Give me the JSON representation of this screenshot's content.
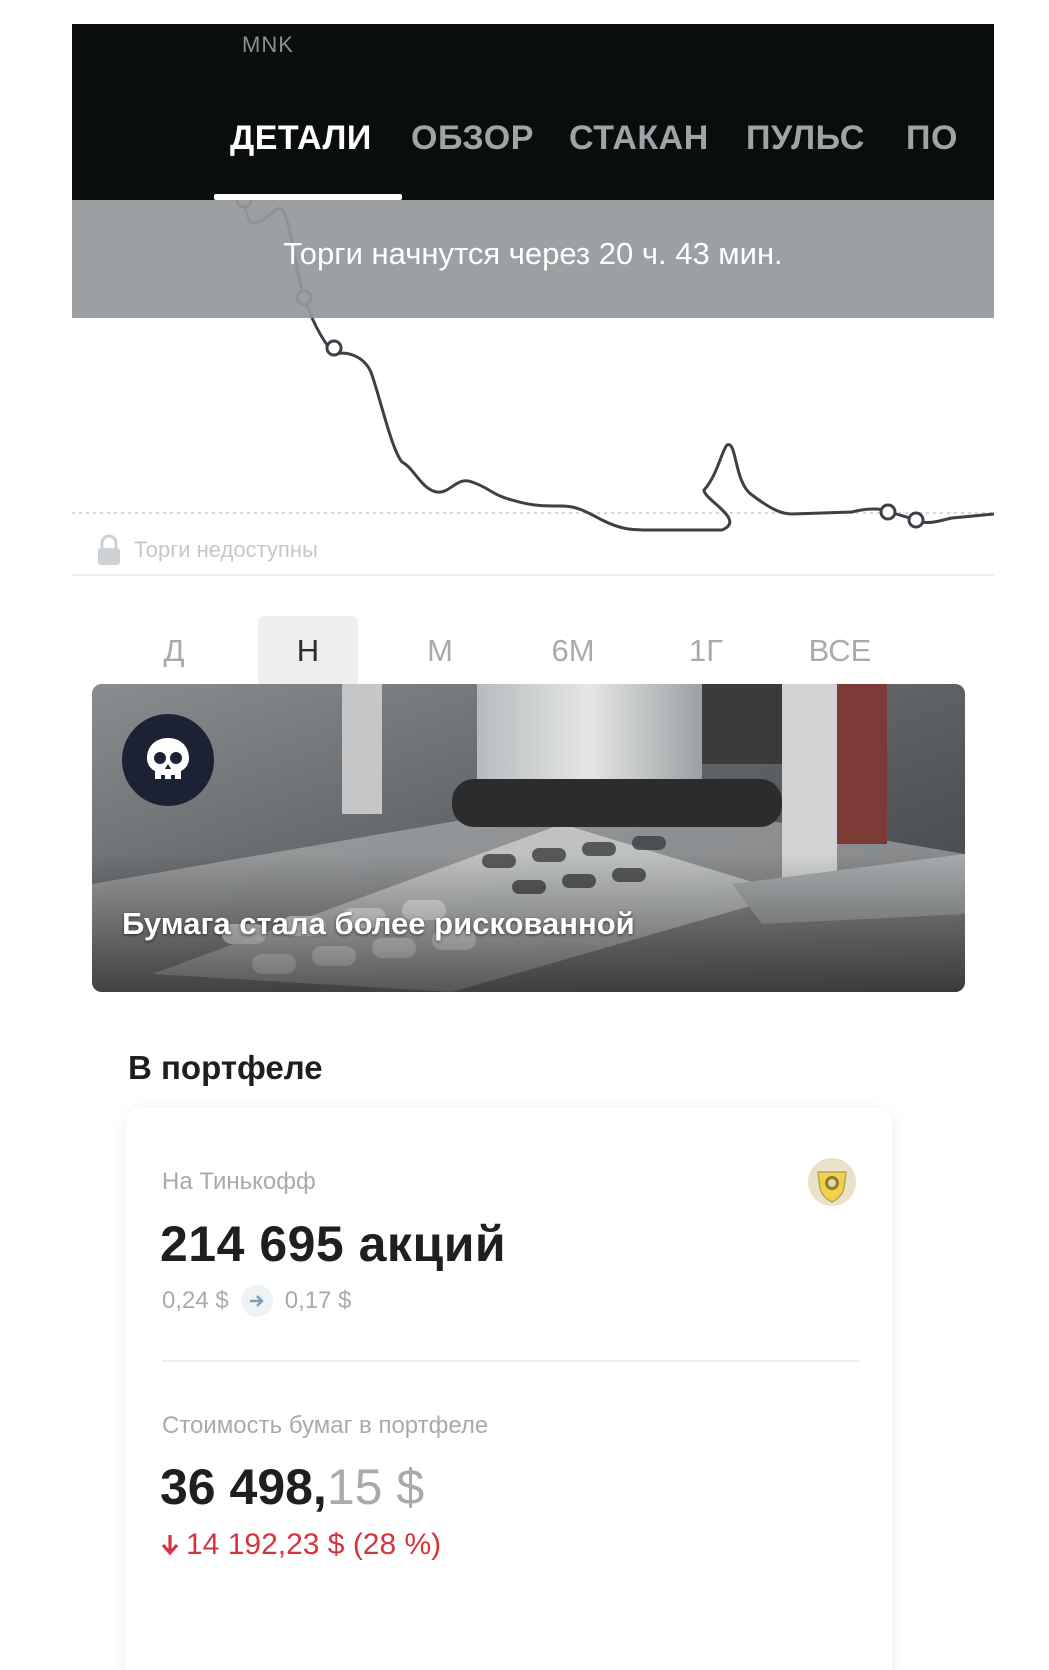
{
  "header": {
    "ticker": "MNK",
    "tabs": [
      {
        "label": "ДЕТАЛИ",
        "active": true
      },
      {
        "label": "ОБЗОР",
        "active": false
      },
      {
        "label": "СТАКАН",
        "active": false
      },
      {
        "label": "ПУЛЬС",
        "active": false
      },
      {
        "label": "ПО",
        "active": false
      }
    ]
  },
  "chart": {
    "banner": "Торги начнутся через 20 ч. 43 мин.",
    "status": "Торги недоступны",
    "line_color": "#3b4147",
    "note": ""
  },
  "periods": [
    {
      "label": "Д",
      "active": false
    },
    {
      "label": "Н",
      "active": true
    },
    {
      "label": "М",
      "active": false
    },
    {
      "label": "6М",
      "active": false
    },
    {
      "label": "1Г",
      "active": false
    },
    {
      "label": "ВСЕ",
      "active": false
    }
  ],
  "news": {
    "title": "Бумага стала более рискованной",
    "badge_icon": "skull-icon"
  },
  "portfolio": {
    "section_title": "В портфеле",
    "broker_label": "На Тинькофф",
    "broker_icon": "tinkoff-logo-icon",
    "shares": "214 695 акций",
    "price_from": "0,24 $",
    "price_to": "0,17 $",
    "value_label": "Стоимость бумаг в портфеле",
    "value_int": "36 498,",
    "value_dec": "15 $",
    "change": "14 192,23 $ (28 %)",
    "change_color": "#d8333a"
  }
}
